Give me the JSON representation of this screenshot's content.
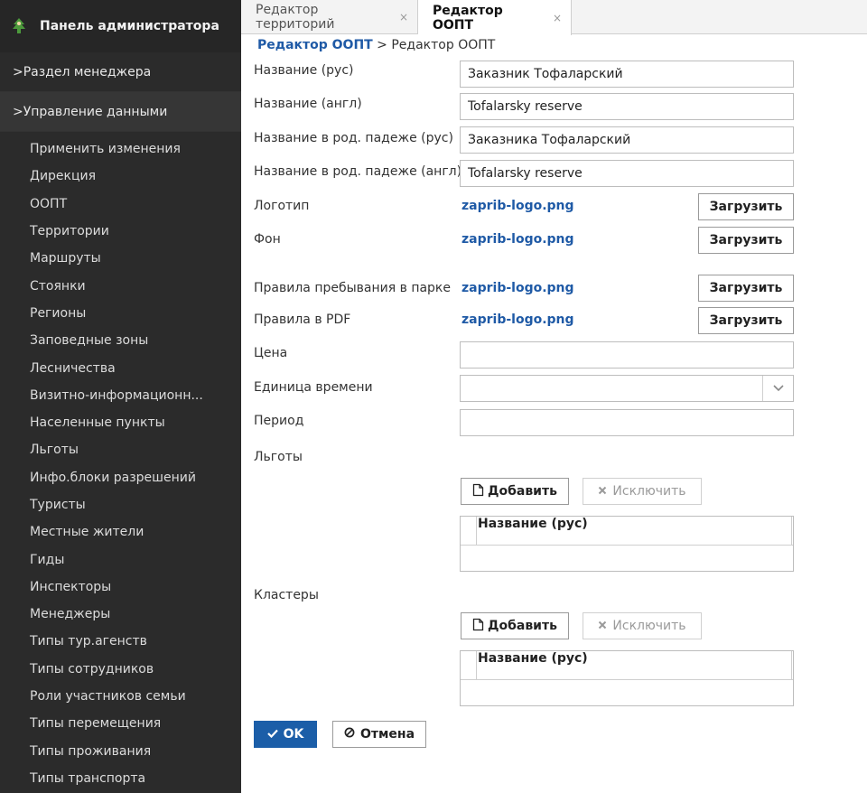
{
  "sidebar": {
    "title": "Панель администратора",
    "sections": [
      ">Раздел менеджера",
      ">Управление данными"
    ],
    "items": [
      "Применить изменения",
      "Дирекция",
      "ООПТ",
      "Территории",
      "Маршруты",
      "Стоянки",
      "Регионы",
      "Заповедные зоны",
      "Лесничества",
      "Визитно-информационн...",
      "Населенные пункты",
      "Льготы",
      "Инфо.блоки разрешений",
      "Туристы",
      "Местные жители",
      "Гиды",
      "Инспекторы",
      "Менеджеры",
      "Типы тур.агенств",
      "Типы сотрудников",
      "Роли участников семьи",
      "Типы перемещения",
      "Типы проживания",
      "Типы транспорта"
    ]
  },
  "tabs": [
    {
      "label": "Редактор территорий",
      "close": "×"
    },
    {
      "label": "Редактор ООПТ",
      "close": "×"
    }
  ],
  "breadcrumb": {
    "link": "Редактор ООПТ",
    "separator": ">",
    "current": "Редактор ООПТ"
  },
  "form": {
    "name_ru": {
      "label": "Название (рус)",
      "value": "Заказник Тофаларский"
    },
    "name_en": {
      "label": "Название (англ)",
      "value": "Tofalarsky reserve"
    },
    "name_gen_ru": {
      "label": "Название в род. падеже (рус)",
      "value": "Заказника Тофаларский"
    },
    "name_gen_en": {
      "label": "Название в род. падеже (англ)",
      "value": "Tofalarsky reserve"
    },
    "logo": {
      "label": "Логотип",
      "file": "zaprib-logo.png",
      "button": "Загрузить"
    },
    "background": {
      "label": "Фон",
      "file": "zaprib-logo.png",
      "button": "Загрузить"
    },
    "rules": {
      "label": "Правила пребывания в парке",
      "file": "zaprib-logo.png",
      "button": "Загрузить"
    },
    "rules_pdf": {
      "label": "Правила в PDF",
      "file": "zaprib-logo.png",
      "button": "Загрузить"
    },
    "price": {
      "label": "Цена",
      "value": ""
    },
    "time_unit": {
      "label": "Единица времени",
      "value": ""
    },
    "period": {
      "label": "Период",
      "value": ""
    },
    "benefits": {
      "label": "Льготы",
      "add": "Добавить",
      "exclude": "Исключить",
      "column": "Название (рус)"
    },
    "clusters": {
      "label": "Кластеры",
      "add": "Добавить",
      "exclude": "Исключить",
      "column": "Название (рус)"
    }
  },
  "actions": {
    "ok": "OK",
    "cancel": "Отмена"
  },
  "colors": {
    "sidebar_bg": "#2b2b2b",
    "accent": "#1b5ea8",
    "link": "#1f5aa6"
  }
}
